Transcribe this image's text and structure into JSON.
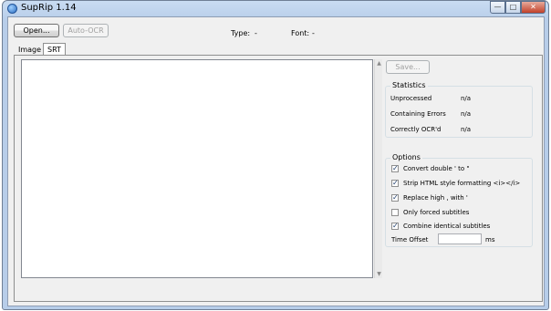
{
  "window": {
    "title": "SupRip 1.14"
  },
  "toolbar": {
    "open_label": "Open...",
    "autoocr_label": "Auto-OCR",
    "type_label": "Type:",
    "type_value": "-",
    "font_label": "Font:",
    "font_value": "-"
  },
  "tabs": [
    {
      "label": "Image"
    },
    {
      "label": "SRT"
    }
  ],
  "save_label": "Save...",
  "statistics": {
    "title": "Statistics",
    "rows": [
      {
        "label": "Unprocessed",
        "value": "n/a"
      },
      {
        "label": "Containing Errors",
        "value": "n/a"
      },
      {
        "label": "Correctly OCR'd",
        "value": "n/a"
      }
    ]
  },
  "options": {
    "title": "Options",
    "items": [
      {
        "label": "Convert double ' to \"",
        "checked": true
      },
      {
        "label": "Strip HTML style formatting <i></i>",
        "checked": true
      },
      {
        "label": "Replace high , with '",
        "checked": true
      },
      {
        "label": "Only forced subtitles",
        "checked": false
      },
      {
        "label": "Combine identical subtitles",
        "checked": true
      }
    ],
    "time_offset_label": "Time Offset",
    "time_offset_value": "",
    "time_offset_unit": "ms"
  }
}
